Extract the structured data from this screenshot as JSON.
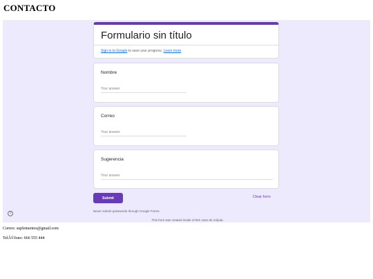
{
  "page": {
    "heading": "CONTACTO"
  },
  "form": {
    "title": "Formulario sin título",
    "signin_link": "Sign in to Google",
    "signin_text": " to save your progress. ",
    "learn_more": "Learn more",
    "questions": [
      {
        "label": "Nombre",
        "placeholder": "Your answer"
      },
      {
        "label": "Correo",
        "placeholder": "Your answer"
      },
      {
        "label": "Sugerencia",
        "placeholder": "Your answer"
      }
    ],
    "submit_label": "Submit",
    "clear_label": "Clear form",
    "password_note": "Never submit passwords through Google Forms.",
    "origin_note": "This form was created inside of IES Juan de Aréjula.",
    "help_glyph": "?",
    "accent_color": "#673ab7",
    "help_icon": "help-circle-icon"
  },
  "contact": {
    "email_line": "Correo: suplementos@gmail.com",
    "phone_line": "TelÃ©fono: 666 555 444"
  }
}
